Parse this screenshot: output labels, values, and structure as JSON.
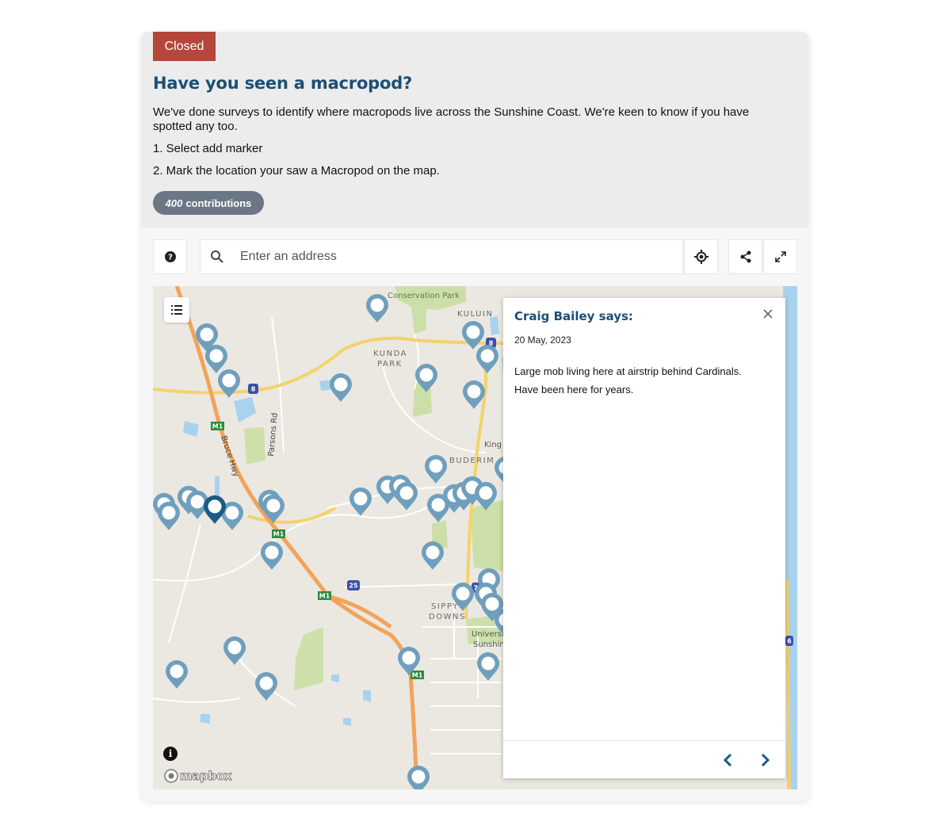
{
  "status_badge": "Closed",
  "title": "Have you seen a macropod?",
  "description": "We've done surveys to identify where macropods live across the Sunshine Coast. We're keen to know if you have spotted any too.",
  "steps": [
    "1. Select add marker",
    "2. Mark the location your saw a Macropod on the map."
  ],
  "contributions": {
    "count": "400",
    "label": "contributions"
  },
  "search": {
    "placeholder": "Enter an address"
  },
  "toolbar": {
    "help_icon": "question-icon",
    "locate_icon": "crosshair-icon",
    "share_icon": "share-icon",
    "fullscreen_icon": "expand-icon"
  },
  "map": {
    "labels": {
      "conservation_park": "Conservation Park",
      "kuluin": "KULUIN",
      "kunda_park": "KUNDA\nPARK",
      "buderim": "BUDERIM",
      "sippy_downs": "SIPPY\nDOWNS",
      "parsons_rd": "Parsons Rd",
      "bruce_hwy": "Bruce Hwy",
      "king": "King",
      "university": "Universi",
      "sunshine": "Sunshin"
    },
    "shields": {
      "m1": "M1",
      "r8": "8",
      "r25": "25",
      "r70": "70",
      "r6": "6"
    },
    "attribution": "mapbox",
    "colors": {
      "marker": "#6f9fbd",
      "marker_selected": "#1c5a86",
      "water": "#a8d2ee",
      "motorway": "#f2a35a",
      "main_road": "#f3d36b",
      "park": "#c8dea0"
    }
  },
  "popup": {
    "author": "Craig Bailey says:",
    "date": "20 May, 2023",
    "body": "Large mob living here at airstrip behind Cardinals. Have been here for years."
  },
  "colors": {
    "title": "#1c4f75",
    "badge": "#b5473a",
    "pill": "#6b7785"
  }
}
